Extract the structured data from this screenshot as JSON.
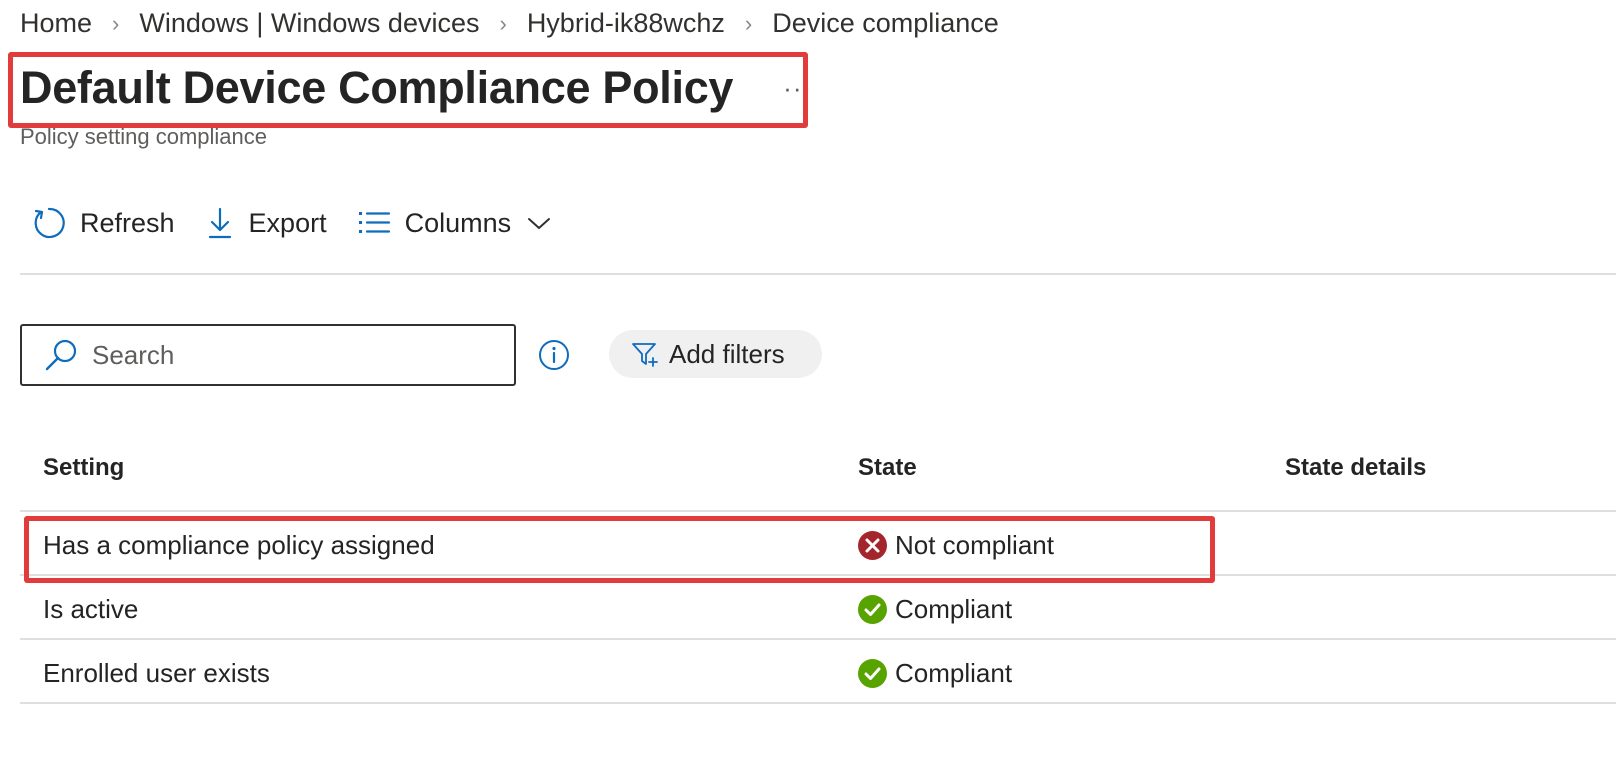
{
  "breadcrumb": [
    "Home",
    "Windows | Windows devices",
    "Hybrid-ik88wchz",
    "Device compliance"
  ],
  "page": {
    "title": "Default Device Compliance Policy",
    "more": "···",
    "subtitle": "Policy setting compliance"
  },
  "toolbar": {
    "refresh": "Refresh",
    "export": "Export",
    "columns": "Columns"
  },
  "search": {
    "placeholder": "Search",
    "value": ""
  },
  "filters": {
    "add_label": "Add filters"
  },
  "table": {
    "headers": [
      "Setting",
      "State",
      "State details"
    ],
    "rows": [
      {
        "setting": "Has a compliance policy assigned",
        "state": "Not compliant",
        "state_icon": "error-circle-icon",
        "details": ""
      },
      {
        "setting": "Is active",
        "state": "Compliant",
        "state_icon": "check-circle-icon",
        "details": ""
      },
      {
        "setting": "Enrolled user exists",
        "state": "Compliant",
        "state_icon": "check-circle-icon",
        "details": ""
      }
    ]
  },
  "colors": {
    "accent": "#0f6cbd",
    "highlight": "#e23b3b",
    "error": "#a4262c",
    "success": "#57a300"
  }
}
